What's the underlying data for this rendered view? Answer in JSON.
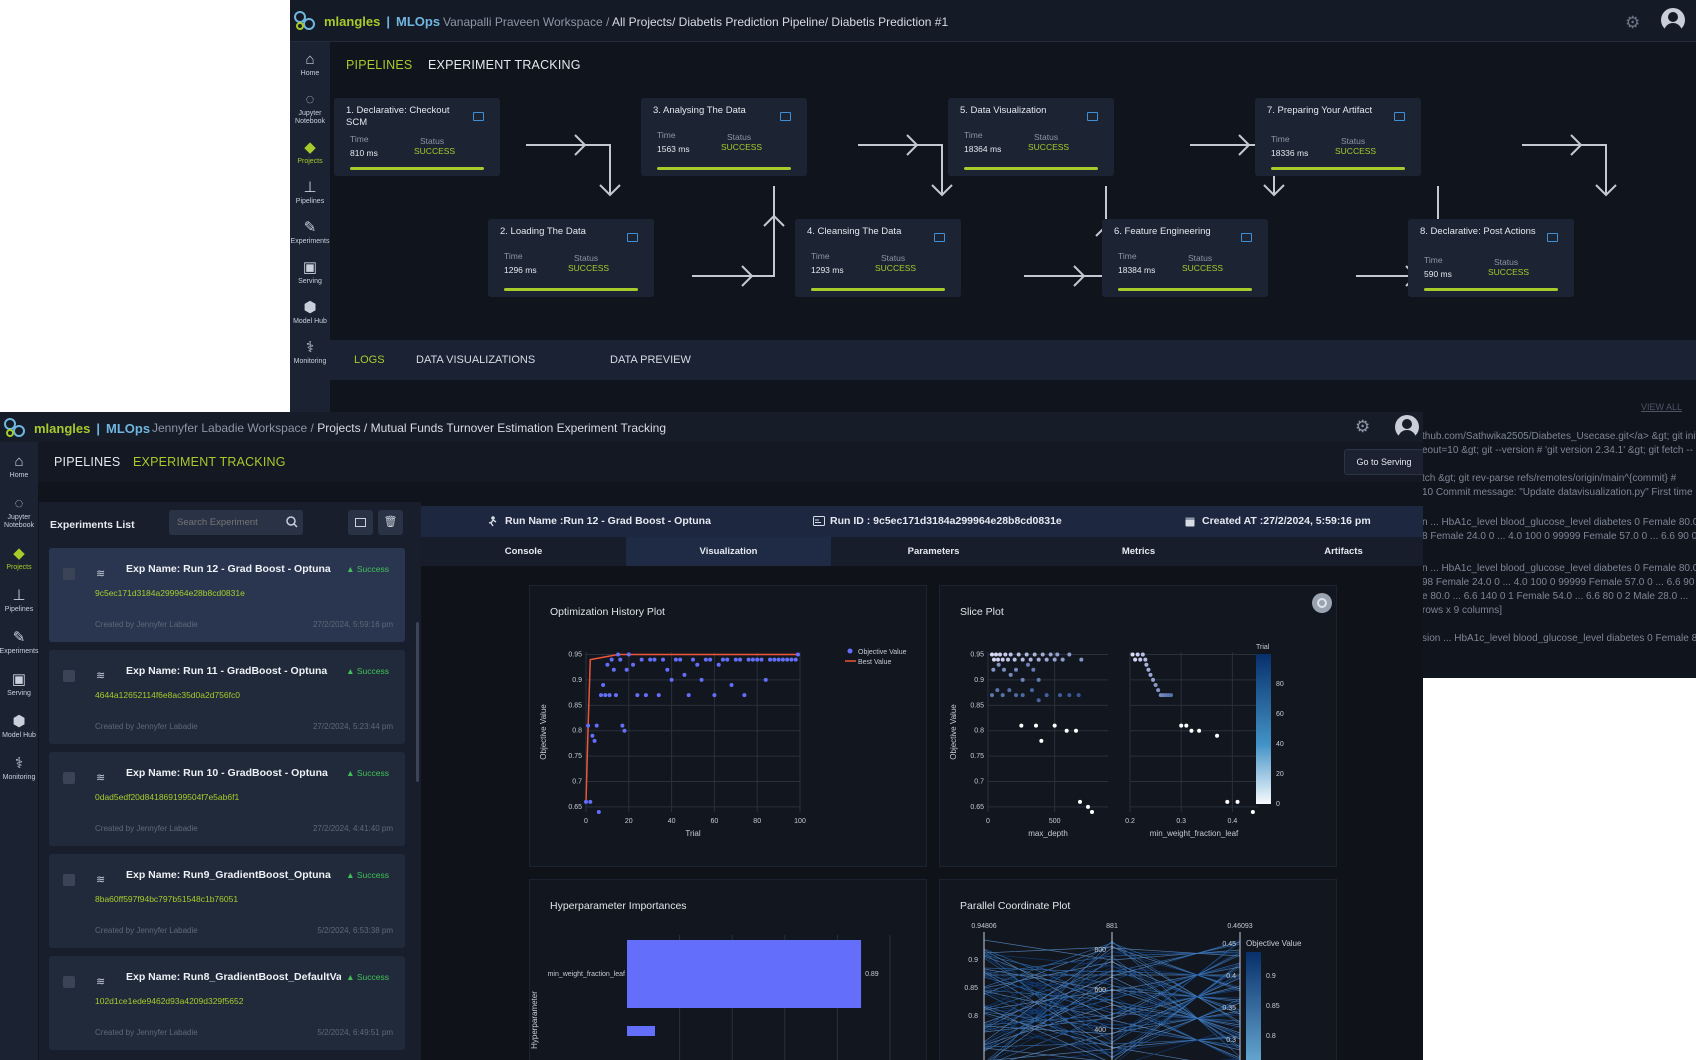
{
  "back": {
    "logo": {
      "part1": "mlangles",
      "part2": "MLOps"
    },
    "breadcrumb": {
      "workspace": "Vanapalli Praveen Workspace / ",
      "path": "All Projects/ Diabetis Prediction Pipeline/ Diabetis Prediction #1"
    },
    "rail": [
      {
        "label": "Home",
        "icon": "⌂"
      },
      {
        "label": "Jupyter Notebook",
        "icon": "◌"
      },
      {
        "label": "Projects",
        "icon": "◆",
        "active": true
      },
      {
        "label": "Pipelines",
        "icon": "⊥"
      },
      {
        "label": "Experiments",
        "icon": "✎"
      },
      {
        "label": "Serving",
        "icon": "▣"
      },
      {
        "label": "Model Hub",
        "icon": "⬢"
      },
      {
        "label": "Monitoring",
        "icon": "⚕"
      }
    ],
    "tabs": {
      "pipelines": "PIPELINES",
      "tracking": "EXPERIMENT TRACKING"
    },
    "time_label": "Time",
    "status_label": "Status",
    "stages": [
      {
        "title": "1. Declarative: Checkout SCM",
        "time": "810 ms",
        "status": "SUCCESS"
      },
      {
        "title": "2. Loading The Data",
        "time": "1296 ms",
        "status": "SUCCESS"
      },
      {
        "title": "3. Analysing The Data",
        "time": "1563 ms",
        "status": "SUCCESS"
      },
      {
        "title": "4. Cleansing The Data",
        "time": "1293 ms",
        "status": "SUCCESS"
      },
      {
        "title": "5. Data Visualization",
        "time": "18364 ms",
        "status": "SUCCESS"
      },
      {
        "title": "6. Feature Engineering",
        "time": "18384 ms",
        "status": "SUCCESS"
      },
      {
        "title": "7. Preparing Your Artifact",
        "time": "18336 ms",
        "status": "SUCCESS"
      },
      {
        "title": "8. Declarative: Post Actions",
        "time": "590 ms",
        "status": "SUCCESS"
      }
    ],
    "log_tabs": {
      "logs": "LOGS",
      "viz": "DATA VISUALIZATIONS",
      "preview": "DATA PREVIEW"
    },
    "view_all": "VIEW ALL",
    "log_lines": [
      "thub.com/Sathwika2505/Diabetes_Usecase.git</a> &gt; git init",
      "eout=10 &gt; git --version # 'git version 2.34.1' &gt; git fetch --",
      "tch &gt; git rev-parse refs/remotes/origin/main^{commit} #",
      "10 Commit message: \"Update datavisualization.py\" First time",
      "n ... HbA1c_level blood_glucose_level diabetes 0 Female 80.0",
      "8 Female 24.0 0 ... 4.0 100 0 99999 Female 57.0 0 ... 6.6 90 0",
      "n ... HbA1c_level blood_glucose_level diabetes 0 Female 80.0",
      "98 Female 24.0 0 ... 4.0 100 0 99999 Female 57.0 0 ... 6.6 90",
      "e 80.0 ... 6.6 140 0 1 Female 54.0 ... 6.6 80 0 2 Male 28.0 ...",
      "rows x 9 columns]",
      "sion ... HbA1c_level blood_glucose_level diabetes 0 Female 80.0"
    ]
  },
  "front": {
    "logo": {
      "part1": "mlangles",
      "part2": "MLOps"
    },
    "breadcrumb": {
      "workspace": "Jennyfer Labadie Workspace / ",
      "path": "Projects / Mutual Funds Turnover Estimation Experiment Tracking"
    },
    "rail": [
      {
        "label": "Home",
        "icon": "⌂"
      },
      {
        "label": "Jupyter Notebook",
        "icon": "◌"
      },
      {
        "label": "Projects",
        "icon": "◆",
        "active": true
      },
      {
        "label": "Pipelines",
        "icon": "⊥"
      },
      {
        "label": "Experiments",
        "icon": "✎"
      },
      {
        "label": "Serving",
        "icon": "▣"
      },
      {
        "label": "Model Hub",
        "icon": "⬢"
      },
      {
        "label": "Monitoring",
        "icon": "⚕"
      }
    ],
    "tabs": {
      "pipelines": "PIPELINES",
      "tracking": "EXPERIMENT TRACKING"
    },
    "go_to_serving": "Go to Serving",
    "experiments_title": "Experiments List",
    "search_placeholder": "Search Experiment",
    "experiments": [
      {
        "name": "Exp Name: Run 12 - Grad Boost - Optuna",
        "status": "Success",
        "run_id": "9c5ec171d3184a299964e28b8cd0831e",
        "by": "Created by Jennyfer Labadie",
        "date": "27/2/2024, 5:59:16 pm",
        "selected": true
      },
      {
        "name": "Exp Name: Run 11 - GradBoost - Optuna",
        "status": "Success",
        "run_id": "4644a12652114f6e8ac35d0a2d756fc0",
        "by": "Created by Jennyfer Labadie",
        "date": "27/2/2024, 5:23:44 pm"
      },
      {
        "name": "Exp Name: Run 10 - GradBoost - Optuna",
        "status": "Success",
        "run_id": "0dad5edf20d841869199504f7e5ab6f1",
        "by": "Created by Jennyfer Labadie",
        "date": "27/2/2024, 4:41:40 pm"
      },
      {
        "name": "Exp Name: Run9_GradientBoost_Optuna",
        "status": "Success",
        "run_id": "8ba60ff597f94bc797b51548c1b76051",
        "by": "Created by Jennyfer Labadie",
        "date": "5/2/2024, 6:53:38 pm"
      },
      {
        "name": "Exp Name: Run8_GradientBoost_DefaultVa...",
        "status": "Success",
        "run_id": "102d1ce1ede9462d93a4209d329f5652",
        "by": "Created by Jennyfer Labadie",
        "date": "5/2/2024, 6:49:51 pm"
      }
    ],
    "run_header": {
      "name": "Run Name :Run 12 - Grad Boost - Optuna",
      "id": "Run ID : 9c5ec171d3184a299964e28b8cd0831e",
      "created": "Created AT :27/2/2024, 5:59:16 pm"
    },
    "view_tabs": [
      "Console",
      "Visualization",
      "Parameters",
      "Metrics",
      "Artifacts"
    ],
    "active_view_tab": "Visualization"
  },
  "chart_data": [
    {
      "type": "scatter",
      "title": "Optimization History Plot",
      "xlabel": "Trial",
      "ylabel": "Objective Value",
      "xlim": [
        0,
        100
      ],
      "ylim": [
        0.64,
        0.955
      ],
      "xticks": [
        0,
        20,
        40,
        60,
        80,
        100
      ],
      "yticks": [
        0.65,
        0.7,
        0.75,
        0.8,
        0.85,
        0.9,
        0.95
      ],
      "legend": [
        "Objective Value",
        "Best Value"
      ],
      "series": [
        {
          "name": "Objective Value",
          "points": [
            [
              0,
              0.66
            ],
            [
              1,
              0.81
            ],
            [
              2,
              0.66
            ],
            [
              3,
              0.79
            ],
            [
              4,
              0.78
            ],
            [
              5,
              0.81
            ],
            [
              6,
              0.64
            ],
            [
              7,
              0.87
            ],
            [
              8,
              0.89
            ],
            [
              9,
              0.87
            ],
            [
              10,
              0.93
            ],
            [
              11,
              0.87
            ],
            [
              12,
              0.94
            ],
            [
              13,
              0.92
            ],
            [
              14,
              0.87
            ],
            [
              15,
              0.95
            ],
            [
              16,
              0.94
            ],
            [
              17,
              0.81
            ],
            [
              18,
              0.8
            ],
            [
              19,
              0.92
            ],
            [
              20,
              0.95
            ],
            [
              22,
              0.93
            ],
            [
              24,
              0.87
            ],
            [
              26,
              0.94
            ],
            [
              28,
              0.87
            ],
            [
              30,
              0.94
            ],
            [
              32,
              0.94
            ],
            [
              34,
              0.87
            ],
            [
              36,
              0.94
            ],
            [
              38,
              0.92
            ],
            [
              40,
              0.9
            ],
            [
              42,
              0.94
            ],
            [
              44,
              0.94
            ],
            [
              46,
              0.91
            ],
            [
              48,
              0.87
            ],
            [
              50,
              0.94
            ],
            [
              52,
              0.93
            ],
            [
              54,
              0.9
            ],
            [
              56,
              0.94
            ],
            [
              58,
              0.94
            ],
            [
              60,
              0.87
            ],
            [
              62,
              0.93
            ],
            [
              64,
              0.94
            ],
            [
              66,
              0.94
            ],
            [
              68,
              0.89
            ],
            [
              70,
              0.94
            ],
            [
              72,
              0.94
            ],
            [
              74,
              0.87
            ],
            [
              76,
              0.94
            ],
            [
              78,
              0.94
            ],
            [
              80,
              0.94
            ],
            [
              82,
              0.94
            ],
            [
              84,
              0.9
            ],
            [
              86,
              0.94
            ],
            [
              88,
              0.94
            ],
            [
              90,
              0.94
            ],
            [
              92,
              0.94
            ],
            [
              94,
              0.94
            ],
            [
              96,
              0.94
            ],
            [
              98,
              0.94
            ],
            [
              99,
              0.95
            ]
          ]
        },
        {
          "name": "Best Value",
          "points": [
            [
              0,
              0.66
            ],
            [
              1,
              0.81
            ],
            [
              2,
              0.94
            ],
            [
              15,
              0.95
            ],
            [
              100,
              0.95
            ]
          ]
        }
      ]
    },
    {
      "type": "scatter",
      "title": "Slice Plot",
      "ylabel": "Objective Value",
      "colorbar": {
        "title": "Trial",
        "ticks": [
          0,
          20,
          40,
          60,
          80
        ]
      },
      "yticks": [
        0.65,
        0.7,
        0.75,
        0.8,
        0.85,
        0.9,
        0.95
      ],
      "ylim": [
        0.64,
        0.955
      ],
      "subplots": [
        {
          "xlabel": "max_depth",
          "xlim": [
            0,
            900
          ],
          "xticks": [
            0,
            500
          ],
          "points": [
            [
              30,
              0.95
            ],
            [
              45,
              0.94
            ],
            [
              60,
              0.95
            ],
            [
              75,
              0.94
            ],
            [
              90,
              0.95
            ],
            [
              110,
              0.94
            ],
            [
              130,
              0.95
            ],
            [
              150,
              0.94
            ],
            [
              170,
              0.95
            ],
            [
              200,
              0.94
            ],
            [
              230,
              0.95
            ],
            [
              260,
              0.94
            ],
            [
              290,
              0.95
            ],
            [
              320,
              0.94
            ],
            [
              350,
              0.95
            ],
            [
              380,
              0.94
            ],
            [
              410,
              0.95
            ],
            [
              440,
              0.94
            ],
            [
              470,
              0.95
            ],
            [
              500,
              0.94
            ],
            [
              520,
              0.95
            ],
            [
              560,
              0.94
            ],
            [
              610,
              0.95
            ],
            [
              700,
              0.94
            ],
            [
              40,
              0.92
            ],
            [
              80,
              0.93
            ],
            [
              120,
              0.92
            ],
            [
              170,
              0.91
            ],
            [
              210,
              0.92
            ],
            [
              260,
              0.9
            ],
            [
              300,
              0.93
            ],
            [
              340,
              0.92
            ],
            [
              380,
              0.9
            ],
            [
              30,
              0.87
            ],
            [
              70,
              0.88
            ],
            [
              110,
              0.87
            ],
            [
              160,
              0.88
            ],
            [
              210,
              0.87
            ],
            [
              260,
              0.87
            ],
            [
              330,
              0.88
            ],
            [
              380,
              0.86
            ],
            [
              440,
              0.87
            ],
            [
              540,
              0.87
            ],
            [
              610,
              0.87
            ],
            [
              680,
              0.87
            ],
            [
              250,
              0.81
            ],
            [
              360,
              0.81
            ],
            [
              400,
              0.78
            ],
            [
              500,
              0.81
            ],
            [
              590,
              0.8
            ],
            [
              660,
              0.8
            ],
            [
              690,
              0.66
            ],
            [
              750,
              0.65
            ],
            [
              780,
              0.64
            ]
          ]
        },
        {
          "xlabel": "min_weight_fraction_leaf",
          "xlim": [
            0.2,
            0.45
          ],
          "xticks": [
            0.2,
            0.3,
            0.4
          ],
          "points": [
            [
              0.205,
              0.95
            ],
            [
              0.21,
              0.94
            ],
            [
              0.215,
              0.95
            ],
            [
              0.22,
              0.94
            ],
            [
              0.225,
              0.95
            ],
            [
              0.23,
              0.94
            ],
            [
              0.232,
              0.93
            ],
            [
              0.236,
              0.92
            ],
            [
              0.24,
              0.91
            ],
            [
              0.245,
              0.9
            ],
            [
              0.25,
              0.89
            ],
            [
              0.255,
              0.88
            ],
            [
              0.26,
              0.87
            ],
            [
              0.265,
              0.87
            ],
            [
              0.27,
              0.87
            ],
            [
              0.275,
              0.87
            ],
            [
              0.28,
              0.87
            ],
            [
              0.3,
              0.81
            ],
            [
              0.31,
              0.81
            ],
            [
              0.32,
              0.8
            ],
            [
              0.335,
              0.8
            ],
            [
              0.37,
              0.79
            ],
            [
              0.39,
              0.66
            ],
            [
              0.41,
              0.66
            ],
            [
              0.44,
              0.64
            ]
          ]
        }
      ]
    },
    {
      "type": "bar",
      "title": "Hyperparameter Importances",
      "ylabel": "Hyperparameter",
      "categories": [
        "min_weight_fraction_leaf"
      ],
      "values": [
        0.89
      ],
      "xlim": [
        0,
        1
      ]
    },
    {
      "type": "parallel",
      "title": "Parallel Coordinate Plot",
      "colorbar": {
        "title": "Objective Value",
        "ticks": [
          0.9,
          0.85,
          0.8
        ]
      },
      "axis_tops": [
        "0.94806",
        "881",
        "0.46093"
      ],
      "tick_labels": [
        "0.9",
        "0.85",
        "0.8",
        "800",
        "600",
        "400",
        "0.45",
        "0.4",
        "0.35",
        "0.3"
      ]
    }
  ]
}
